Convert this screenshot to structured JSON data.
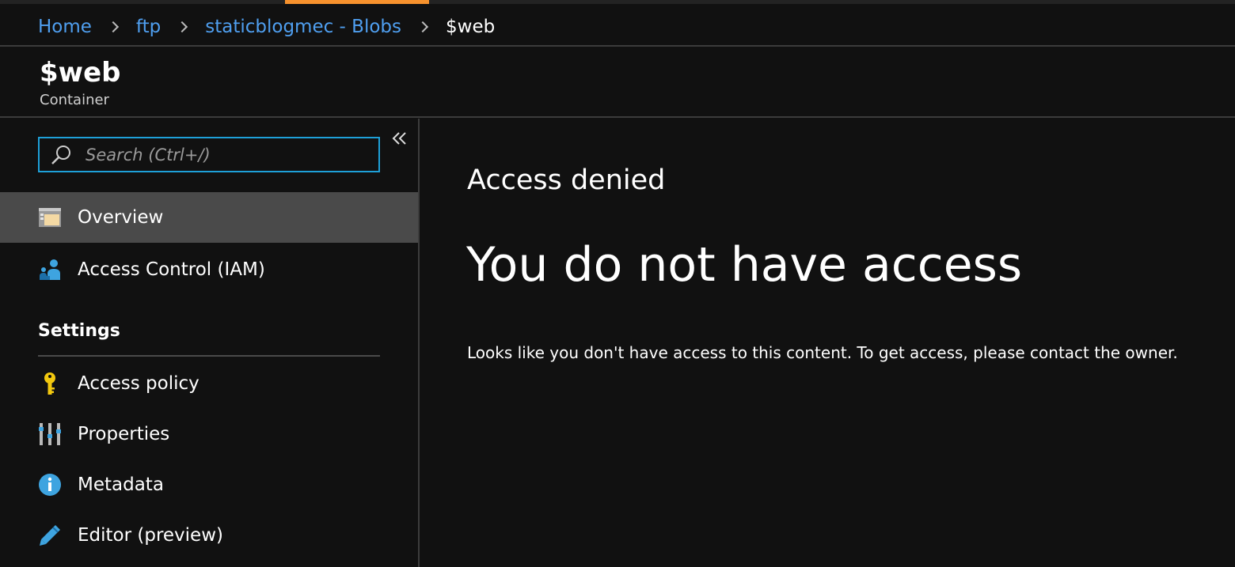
{
  "breadcrumb": {
    "items": [
      {
        "label": "Home"
      },
      {
        "label": "ftp"
      },
      {
        "label": "staticblogmec - Blobs"
      }
    ],
    "current": "$web"
  },
  "header": {
    "title": "$web",
    "subtitle": "Container"
  },
  "sidebar": {
    "search": {
      "placeholder": "Search (Ctrl+/)",
      "value": ""
    },
    "collapse_icon": "double-chevron-left-icon",
    "items": [
      {
        "label": "Overview",
        "icon": "overview-icon",
        "active": true
      },
      {
        "label": "Access Control (IAM)",
        "icon": "iam-people-icon",
        "active": false
      }
    ],
    "settings": {
      "heading": "Settings",
      "items": [
        {
          "label": "Access policy",
          "icon": "key-icon"
        },
        {
          "label": "Properties",
          "icon": "properties-sliders-icon"
        },
        {
          "label": "Metadata",
          "icon": "info-icon"
        },
        {
          "label": "Editor (preview)",
          "icon": "pencil-icon"
        }
      ]
    }
  },
  "content": {
    "eyebrow": "Access denied",
    "headline": "You do not have access",
    "message": "Looks like you don't have access to this content. To get access, please contact the owner."
  },
  "colors": {
    "background": "#111111",
    "link": "#4f9ff0",
    "accent": "#f7922d",
    "search_border": "#1ea0d8",
    "active_item": "#4a4a4a"
  }
}
